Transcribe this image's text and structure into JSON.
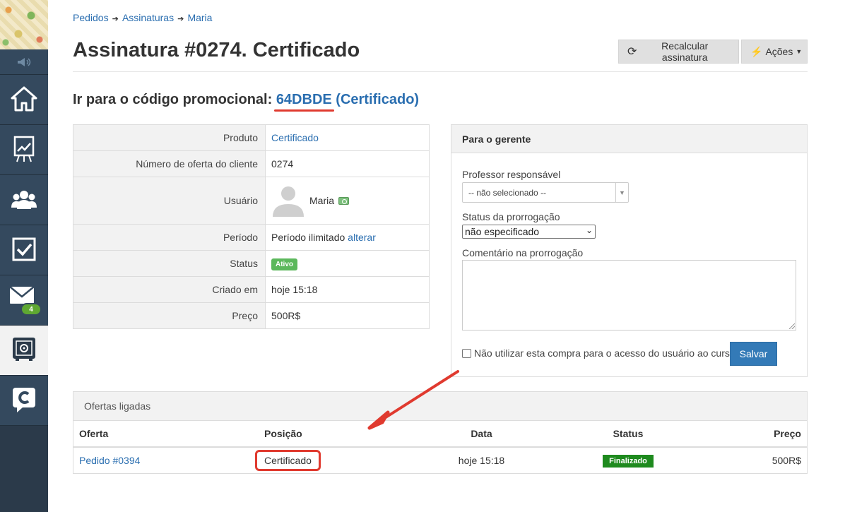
{
  "sidebar": {
    "items": [
      {
        "name": "home-icon",
        "badge": null
      },
      {
        "name": "chart-board-icon",
        "badge": null
      },
      {
        "name": "users-icon",
        "badge": null
      },
      {
        "name": "checkbox-icon",
        "badge": null
      },
      {
        "name": "mail-icon",
        "badge": "4"
      },
      {
        "name": "safe-icon",
        "badge": null,
        "active": true
      },
      {
        "name": "chat-c-icon",
        "badge": null
      }
    ]
  },
  "breadcrumb": [
    "Pedidos",
    "Assinaturas",
    "Maria"
  ],
  "page": {
    "title": "Assinatura #0274. Certificado",
    "recalc_label": "Recalcular assinatura",
    "actions_label": "Ações"
  },
  "promo": {
    "prefix": "Ir para o código promocional:",
    "code": "64DBDE",
    "product": "(Certificado)"
  },
  "details": {
    "produto_label": "Produto",
    "produto_value": "Certificado",
    "numero_label": "Número de oferta do cliente",
    "numero_value": "0274",
    "usuario_label": "Usuário",
    "usuario_value": "Maria",
    "periodo_label": "Período",
    "periodo_value": "Período ilimitado",
    "periodo_link": "alterar",
    "status_label": "Status",
    "status_value": "Ativo",
    "criado_label": "Criado em",
    "criado_value": "hoje 15:18",
    "preco_label": "Preço",
    "preco_value": "500R$"
  },
  "manager": {
    "title": "Para o gerente",
    "professor_label": "Professor responsável",
    "professor_value": "-- não selecionado --",
    "prorrogacao_label": "Status da prorrogação",
    "prorrogacao_value": "não especificado",
    "comentario_label": "Comentário na prorrogação",
    "comentario_value": "",
    "checkbox_label": "Não utilizar esta compra para o acesso do usuário ao curso",
    "save_label": "Salvar"
  },
  "linked": {
    "title": "Ofertas ligadas",
    "columns": [
      "Oferta",
      "Posição",
      "Data",
      "Status",
      "Preço"
    ],
    "rows": [
      {
        "oferta": "Pedido #0394",
        "posicao": "Certificado",
        "data": "hoje 15:18",
        "status": "Finalizado",
        "preco": "500R$"
      }
    ]
  },
  "colors": {
    "link": "#2a6eb0",
    "annotation": "#e03a2f",
    "sidebar": "#34495e",
    "status_active": "#5cb85c",
    "status_finalized": "#1e8a1e",
    "primary_button": "#337ab7"
  }
}
